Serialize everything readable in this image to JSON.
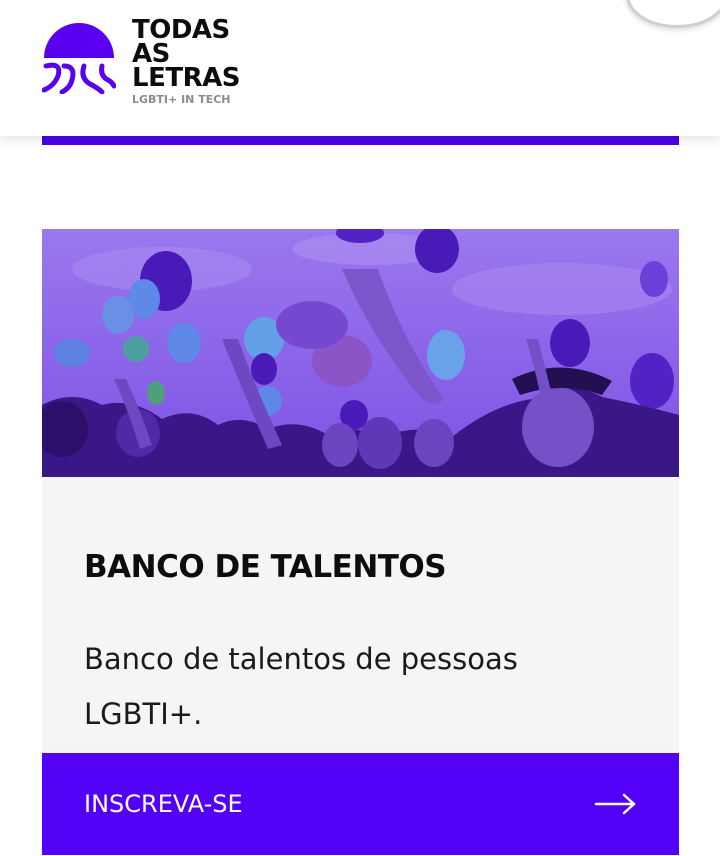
{
  "brand": {
    "name_lines": [
      "TODAS",
      "AS",
      "LETRAS"
    ],
    "tagline": "LGBTI+ IN TECH",
    "logo_icon": "jellyfish-logo-icon",
    "accent_color": "#5300f7"
  },
  "card": {
    "image": "photo of crowd releasing balloons with purple overlay",
    "title": "BANCO DE TALENTOS",
    "description": "Banco de talentos de pessoas LGBTI+.",
    "cta": {
      "label": "INSCREVA-SE",
      "icon": "arrow-right-icon"
    }
  }
}
